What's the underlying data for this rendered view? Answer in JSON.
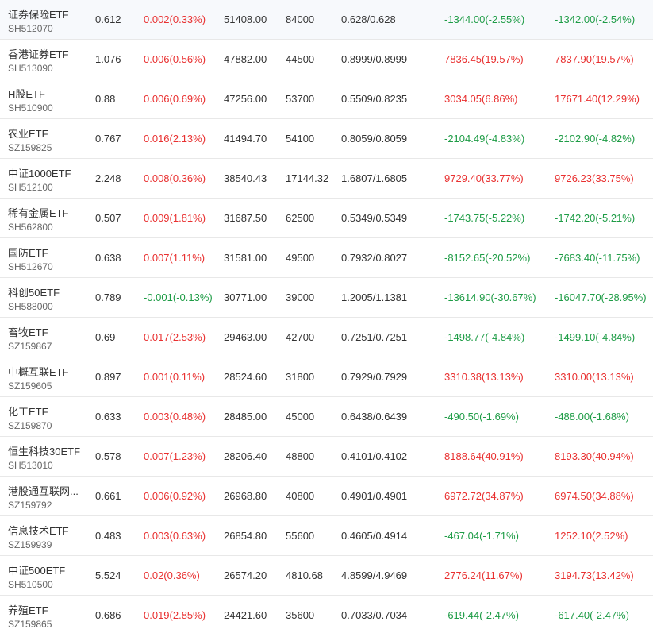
{
  "colors": {
    "up": "#e93030",
    "down": "#1e9c46",
    "text": "#333333",
    "subtext": "#666666"
  },
  "rows": [
    {
      "name": "证券保险ETF",
      "code": "SH512070",
      "price": "0.612",
      "change": "0.002(0.33%)",
      "change_dir": "up",
      "f1": "51408.00",
      "f2": "84000",
      "f3": "0.628/0.628",
      "f4": "-1344.00(-2.55%)",
      "f4_dir": "down",
      "f5": "-1342.00(-2.54%)",
      "f5_dir": "down"
    },
    {
      "name": "香港证券ETF",
      "code": "SH513090",
      "price": "1.076",
      "change": "0.006(0.56%)",
      "change_dir": "up",
      "f1": "47882.00",
      "f2": "44500",
      "f3": "0.8999/0.8999",
      "f4": "7836.45(19.57%)",
      "f4_dir": "up",
      "f5": "7837.90(19.57%)",
      "f5_dir": "up"
    },
    {
      "name": "H股ETF",
      "code": "SH510900",
      "price": "0.88",
      "change": "0.006(0.69%)",
      "change_dir": "up",
      "f1": "47256.00",
      "f2": "53700",
      "f3": "0.5509/0.8235",
      "f4": "3034.05(6.86%)",
      "f4_dir": "up",
      "f5": "17671.40(12.29%)",
      "f5_dir": "up"
    },
    {
      "name": "农业ETF",
      "code": "SZ159825",
      "price": "0.767",
      "change": "0.016(2.13%)",
      "change_dir": "up",
      "f1": "41494.70",
      "f2": "54100",
      "f3": "0.8059/0.8059",
      "f4": "-2104.49(-4.83%)",
      "f4_dir": "down",
      "f5": "-2102.90(-4.82%)",
      "f5_dir": "down"
    },
    {
      "name": "中证1000ETF",
      "code": "SH512100",
      "price": "2.248",
      "change": "0.008(0.36%)",
      "change_dir": "up",
      "f1": "38540.43",
      "f2": "17144.32",
      "f3": "1.6807/1.6805",
      "f4": "9729.40(33.77%)",
      "f4_dir": "up",
      "f5": "9726.23(33.75%)",
      "f5_dir": "up"
    },
    {
      "name": "稀有金属ETF",
      "code": "SH562800",
      "price": "0.507",
      "change": "0.009(1.81%)",
      "change_dir": "up",
      "f1": "31687.50",
      "f2": "62500",
      "f3": "0.5349/0.5349",
      "f4": "-1743.75(-5.22%)",
      "f4_dir": "down",
      "f5": "-1742.20(-5.21%)",
      "f5_dir": "down"
    },
    {
      "name": "国防ETF",
      "code": "SH512670",
      "price": "0.638",
      "change": "0.007(1.11%)",
      "change_dir": "up",
      "f1": "31581.00",
      "f2": "49500",
      "f3": "0.7932/0.8027",
      "f4": "-8152.65(-20.52%)",
      "f4_dir": "down",
      "f5": "-7683.40(-11.75%)",
      "f5_dir": "down"
    },
    {
      "name": "科创50ETF",
      "code": "SH588000",
      "price": "0.789",
      "change": "-0.001(-0.13%)",
      "change_dir": "down",
      "f1": "30771.00",
      "f2": "39000",
      "f3": "1.2005/1.1381",
      "f4": "-13614.90(-30.67%)",
      "f4_dir": "down",
      "f5": "-16047.70(-28.95%)",
      "f5_dir": "down"
    },
    {
      "name": "畜牧ETF",
      "code": "SZ159867",
      "price": "0.69",
      "change": "0.017(2.53%)",
      "change_dir": "up",
      "f1": "29463.00",
      "f2": "42700",
      "f3": "0.7251/0.7251",
      "f4": "-1498.77(-4.84%)",
      "f4_dir": "down",
      "f5": "-1499.10(-4.84%)",
      "f5_dir": "down"
    },
    {
      "name": "中概互联ETF",
      "code": "SZ159605",
      "price": "0.897",
      "change": "0.001(0.11%)",
      "change_dir": "up",
      "f1": "28524.60",
      "f2": "31800",
      "f3": "0.7929/0.7929",
      "f4": "3310.38(13.13%)",
      "f4_dir": "up",
      "f5": "3310.00(13.13%)",
      "f5_dir": "up"
    },
    {
      "name": "化工ETF",
      "code": "SZ159870",
      "price": "0.633",
      "change": "0.003(0.48%)",
      "change_dir": "up",
      "f1": "28485.00",
      "f2": "45000",
      "f3": "0.6438/0.6439",
      "f4": "-490.50(-1.69%)",
      "f4_dir": "down",
      "f5": "-488.00(-1.68%)",
      "f5_dir": "down"
    },
    {
      "name": "恒生科技30ETF",
      "code": "SH513010",
      "price": "0.578",
      "change": "0.007(1.23%)",
      "change_dir": "up",
      "f1": "28206.40",
      "f2": "48800",
      "f3": "0.4101/0.4102",
      "f4": "8188.64(40.91%)",
      "f4_dir": "up",
      "f5": "8193.30(40.94%)",
      "f5_dir": "up"
    },
    {
      "name": "港股通互联网...",
      "code": "SZ159792",
      "price": "0.661",
      "change": "0.006(0.92%)",
      "change_dir": "up",
      "f1": "26968.80",
      "f2": "40800",
      "f3": "0.4901/0.4901",
      "f4": "6972.72(34.87%)",
      "f4_dir": "up",
      "f5": "6974.50(34.88%)",
      "f5_dir": "up"
    },
    {
      "name": "信息技术ETF",
      "code": "SZ159939",
      "price": "0.483",
      "change": "0.003(0.63%)",
      "change_dir": "up",
      "f1": "26854.80",
      "f2": "55600",
      "f3": "0.4605/0.4914",
      "f4": "-467.04(-1.71%)",
      "f4_dir": "down",
      "f5": "1252.10(2.52%)",
      "f5_dir": "up"
    },
    {
      "name": "中证500ETF",
      "code": "SH510500",
      "price": "5.524",
      "change": "0.02(0.36%)",
      "change_dir": "up",
      "f1": "26574.20",
      "f2": "4810.68",
      "f3": "4.8599/4.9469",
      "f4": "2776.24(11.67%)",
      "f4_dir": "up",
      "f5": "3194.73(13.42%)",
      "f5_dir": "up"
    },
    {
      "name": "养殖ETF",
      "code": "SZ159865",
      "price": "0.686",
      "change": "0.019(2.85%)",
      "change_dir": "up",
      "f1": "24421.60",
      "f2": "35600",
      "f3": "0.7033/0.7034",
      "f4": "-619.44(-2.47%)",
      "f4_dir": "down",
      "f5": "-617.40(-2.47%)",
      "f5_dir": "down"
    }
  ]
}
